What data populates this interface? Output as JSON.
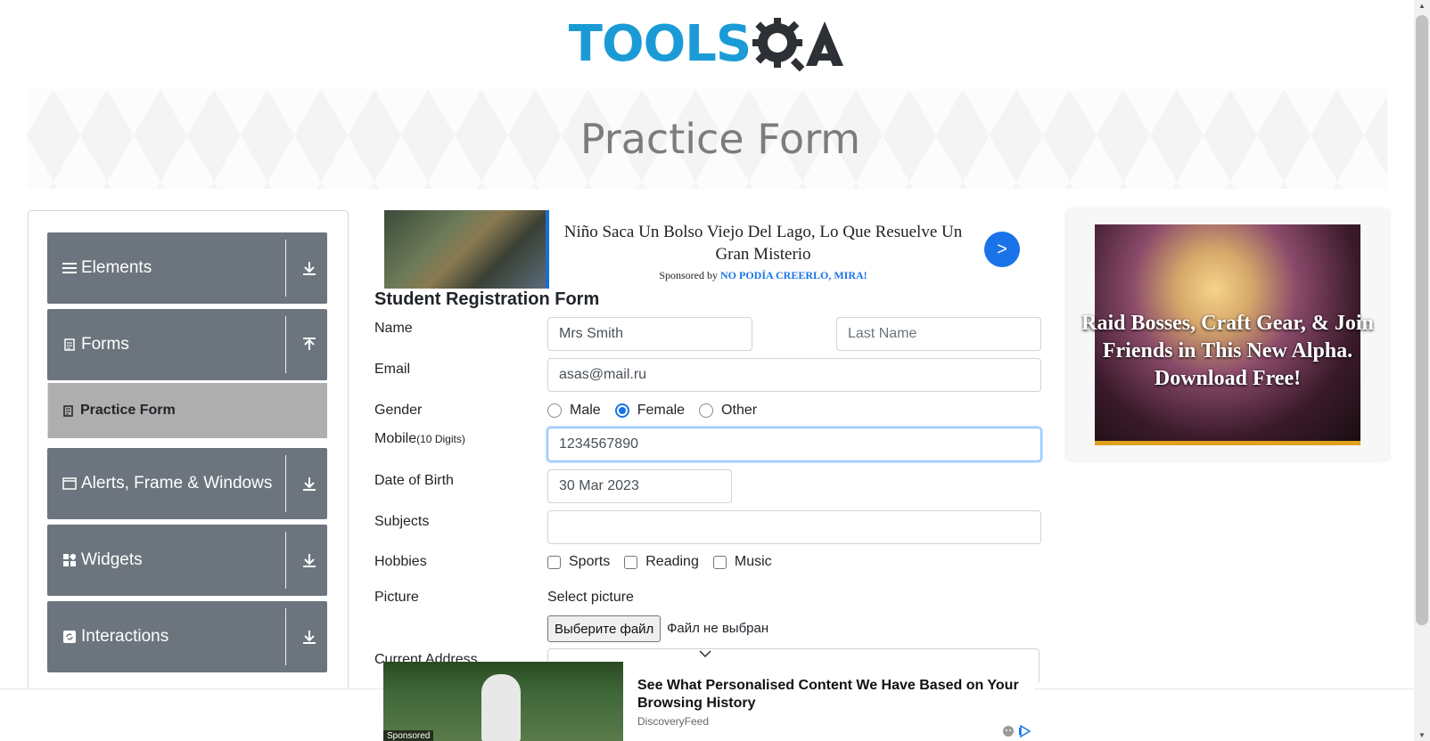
{
  "logo": {
    "part1": "TOOLS",
    "part2": "QA"
  },
  "banner": {
    "title": "Practice Form"
  },
  "sidebar": {
    "groups": [
      {
        "label": "Elements",
        "icon": "list-icon",
        "arrow": "download-icon"
      },
      {
        "label": "Forms",
        "icon": "document-icon",
        "arrow": "upload-icon"
      },
      {
        "label": "Alerts, Frame & Windows",
        "icon": "window-icon",
        "arrow": "download-icon"
      },
      {
        "label": "Widgets",
        "icon": "widgets-icon",
        "arrow": "download-icon"
      },
      {
        "label": "Interactions",
        "icon": "refresh-icon",
        "arrow": "download-icon"
      }
    ],
    "active_item": {
      "label": "Practice Form",
      "icon": "form-icon"
    }
  },
  "top_ad": {
    "title": "Niño Saca Un Bolso Viejo Del Lago, Lo Que Resuelve Un Gran Misterio",
    "sponsored_by": "Sponsored by",
    "sponsor": "NO PODÍA CREERLO, MIRA!",
    "go_label": ">"
  },
  "form": {
    "title": "Student Registration Form",
    "name_label": "Name",
    "first_name_value": "Mrs Smith",
    "last_name_placeholder": "Last Name",
    "email_label": "Email",
    "email_value": "asas@mail.ru",
    "gender_label": "Gender",
    "gender_options": [
      "Male",
      "Female",
      "Other"
    ],
    "gender_selected": "Female",
    "mobile_label": "Mobile",
    "mobile_hint": "(10 Digits)",
    "mobile_value": "1234567890",
    "dob_label": "Date of Birth",
    "dob_value": "30 Mar 2023",
    "subjects_label": "Subjects",
    "subjects_value": "",
    "hobbies_label": "Hobbies",
    "hobbies_options": [
      "Sports",
      "Reading",
      "Music"
    ],
    "picture_label": "Picture",
    "picture_prompt": "Select picture",
    "file_button": "Выберите файл",
    "file_status": "Файл не выбран",
    "address_label": "Current Address"
  },
  "right_ad": {
    "text": "Raid Bosses, Craft Gear, & Join Friends in This New Alpha. Download Free!"
  },
  "bottom_ad": {
    "title": "See What Personalised Content We Have Based on Your Browsing History",
    "source": "DiscoveryFeed",
    "sponsored": "Sponsored"
  },
  "colors": {
    "brand": "#1b9bd6",
    "sidebar": "#6c757d",
    "active": "#aeaeae",
    "accent": "#1a73e8"
  }
}
